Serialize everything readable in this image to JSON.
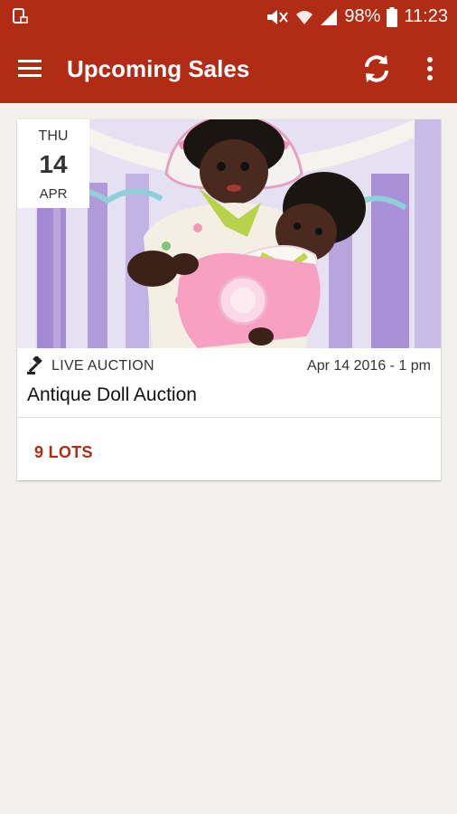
{
  "status_bar": {
    "battery_text": "98%",
    "time": "11:23",
    "icons": [
      "screenshot-icon",
      "mute-icon",
      "wifi-icon",
      "signal-icon",
      "battery-icon"
    ]
  },
  "app_bar": {
    "title": "Upcoming Sales",
    "icons": [
      "menu-icon",
      "refresh-icon",
      "more-vert-icon"
    ]
  },
  "colors": {
    "primary": "#b22b15",
    "background": "#f2f1ee",
    "card": "#ffffff"
  },
  "sales": [
    {
      "date_badge": {
        "day_of_week": "THU",
        "day": "14",
        "month": "APR"
      },
      "type": "LIVE AUCTION",
      "type_icon": "gavel-icon",
      "datetime": "Apr 14 2016 - 1 pm",
      "title": "Antique Doll Auction",
      "lots_label": "9 LOTS",
      "image": "photo of two dolls in plastic packaging"
    }
  ]
}
